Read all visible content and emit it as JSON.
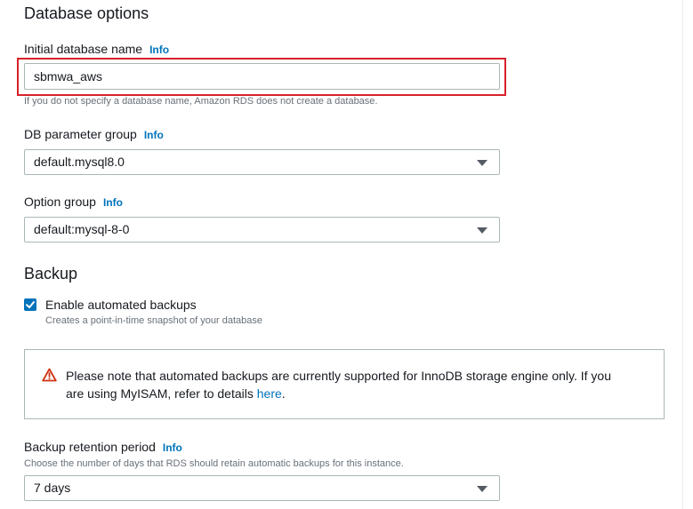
{
  "database_options": {
    "title": "Database options",
    "initial_db_name": {
      "label": "Initial database name",
      "info": "Info",
      "value": "sbmwa_aws",
      "hint": "If you do not specify a database name, Amazon RDS does not create a database."
    },
    "db_parameter_group": {
      "label": "DB parameter group",
      "info": "Info",
      "selected": "default.mysql8.0"
    },
    "option_group": {
      "label": "Option group",
      "info": "Info",
      "selected": "default:mysql-8-0"
    }
  },
  "backup": {
    "title": "Backup",
    "enable_automated": {
      "label": "Enable automated backups",
      "description": "Creates a point-in-time snapshot of your database",
      "checked": true
    },
    "alert": {
      "line1": "Please note that automated backups are currently supported for InnoDB storage engine only. If you",
      "line2_prefix": "are using MyISAM, refer to details ",
      "link": "here",
      "line2_suffix": "."
    },
    "retention": {
      "label": "Backup retention period",
      "info": "Info",
      "hint": "Choose the number of days that RDS should retain automatic backups for this instance.",
      "selected": "7 days"
    }
  },
  "colors": {
    "accent": "#0073bb",
    "highlight": "#d6222a",
    "warning": "#d13212"
  }
}
